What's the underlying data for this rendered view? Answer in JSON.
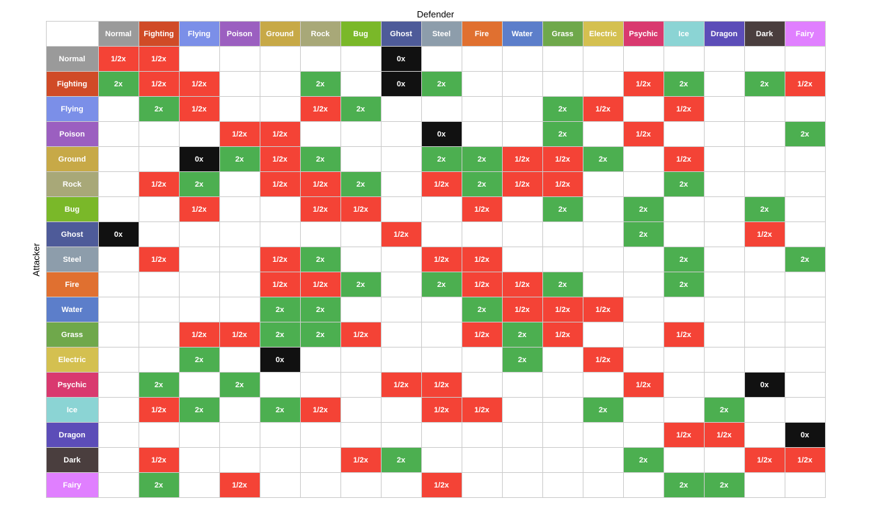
{
  "title": "Defender",
  "attacker_label": "Attacker",
  "types": [
    "Normal",
    "Fighting",
    "Flying",
    "Poison",
    "Ground",
    "Rock",
    "Bug",
    "Ghost",
    "Steel",
    "Fire",
    "Water",
    "Grass",
    "Electric",
    "Psychic",
    "Ice",
    "Dragon",
    "Dark",
    "Fairy"
  ],
  "rows": [
    {
      "type": "Normal",
      "values": [
        "half",
        "half",
        "",
        "",
        "",
        "",
        "",
        "zero",
        "",
        "",
        "",
        "",
        "",
        "",
        "",
        "",
        "",
        ""
      ]
    },
    {
      "type": "Fighting",
      "values": [
        "2x",
        "half",
        "half",
        "",
        "",
        "2x",
        "",
        "zero",
        "2x",
        "",
        "",
        "",
        "",
        "half",
        "2x",
        "",
        "2x",
        "half"
      ]
    },
    {
      "type": "Flying",
      "values": [
        "",
        "2x",
        "half",
        "",
        "",
        "half",
        "2x",
        "",
        "",
        "",
        "",
        "2x",
        "half",
        "",
        "half",
        "",
        "",
        ""
      ]
    },
    {
      "type": "Poison",
      "values": [
        "",
        "",
        "",
        "half",
        "half",
        "",
        "",
        "",
        "zero",
        "",
        "",
        "2x",
        "",
        "half",
        "",
        "",
        "",
        "2x"
      ]
    },
    {
      "type": "Ground",
      "values": [
        "",
        "",
        "zero",
        "2x",
        "half",
        "2x",
        "",
        "",
        "2x",
        "2x",
        "half",
        "half",
        "2x",
        "",
        "half",
        "",
        "",
        ""
      ]
    },
    {
      "type": "Rock",
      "values": [
        "",
        "half",
        "2x",
        "",
        "half",
        "half",
        "2x",
        "",
        "half",
        "2x",
        "half",
        "half",
        "",
        "",
        "2x",
        "",
        "",
        ""
      ]
    },
    {
      "type": "Bug",
      "values": [
        "",
        "",
        "half",
        "",
        "",
        "half",
        "half",
        "",
        "",
        "half",
        "",
        "2x",
        "",
        "2x",
        "",
        "",
        "2x",
        ""
      ]
    },
    {
      "type": "Ghost",
      "values": [
        "zero",
        "",
        "",
        "",
        "",
        "",
        "",
        "half",
        "",
        "",
        "",
        "",
        "",
        "2x",
        "",
        "",
        "half",
        ""
      ]
    },
    {
      "type": "Steel",
      "values": [
        "",
        "half",
        "",
        "",
        "half",
        "2x",
        "",
        "",
        "half",
        "half",
        "",
        "",
        "",
        "",
        "2x",
        "",
        "",
        "2x"
      ]
    },
    {
      "type": "Fire",
      "values": [
        "",
        "",
        "",
        "",
        "half",
        "half",
        "2x",
        "",
        "2x",
        "half",
        "half",
        "2x",
        "",
        "",
        "2x",
        "",
        "",
        ""
      ]
    },
    {
      "type": "Water",
      "values": [
        "",
        "",
        "",
        "",
        "2x",
        "2x",
        "",
        "",
        "",
        "2x",
        "half",
        "half",
        "half",
        "",
        "",
        "",
        "",
        ""
      ]
    },
    {
      "type": "Grass",
      "values": [
        "",
        "",
        "half",
        "half",
        "2x",
        "2x",
        "half",
        "",
        "",
        "half",
        "2x",
        "half",
        "",
        "",
        "half",
        "",
        "",
        ""
      ]
    },
    {
      "type": "Electric",
      "values": [
        "",
        "",
        "2x",
        "",
        "zero",
        "",
        "",
        "",
        "",
        "",
        "2x",
        "",
        "half",
        "",
        "",
        "",
        "",
        ""
      ]
    },
    {
      "type": "Psychic",
      "values": [
        "",
        "2x",
        "",
        "2x",
        "",
        "",
        "",
        "half",
        "half",
        "",
        "",
        "",
        "",
        "half",
        "",
        "",
        "zero",
        ""
      ]
    },
    {
      "type": "Ice",
      "values": [
        "",
        "half",
        "2x",
        "",
        "2x",
        "half",
        "",
        "",
        "half",
        "half",
        "",
        "",
        "2x",
        "",
        "",
        "2x",
        "",
        ""
      ]
    },
    {
      "type": "Dragon",
      "values": [
        "",
        "",
        "",
        "",
        "",
        "",
        "",
        "",
        "",
        "",
        "",
        "",
        "",
        "",
        "half",
        "half",
        "",
        "zero"
      ]
    },
    {
      "type": "Dark",
      "values": [
        "",
        "half",
        "",
        "",
        "",
        "",
        "half",
        "2x",
        "",
        "",
        "",
        "",
        "",
        "2x",
        "",
        "",
        "half",
        "half"
      ]
    },
    {
      "type": "Fairy",
      "values": [
        "",
        "2x",
        "",
        "half",
        "",
        "",
        "",
        "",
        "half",
        "",
        "",
        "",
        "",
        "",
        "2x",
        "2x",
        "",
        ""
      ]
    }
  ]
}
